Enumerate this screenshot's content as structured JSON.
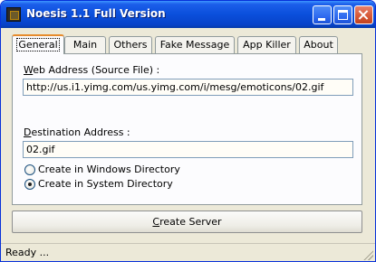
{
  "window": {
    "title": "Noesis 1.1 Full Version"
  },
  "tabs": [
    {
      "label": "General",
      "active": true
    },
    {
      "label": "Main",
      "active": false
    },
    {
      "label": "Others",
      "active": false
    },
    {
      "label": "Fake Message",
      "active": false
    },
    {
      "label": "App Killer",
      "active": false
    },
    {
      "label": "About",
      "active": false
    }
  ],
  "general": {
    "web_address_label_mnemonic": "W",
    "web_address_label_rest": "eb Address (Source File) :",
    "web_address_value": "http://us.i1.yimg.com/us.yimg.com/i/mesg/emoticons/02.gif",
    "destination_label_mnemonic": "D",
    "destination_label_rest": "estination Address :",
    "destination_value": "02.gif",
    "radio_options": [
      {
        "label": "Create in Windows Directory",
        "checked": false
      },
      {
        "label": "Create in System Directory",
        "checked": true
      }
    ]
  },
  "create_button": {
    "mnemonic": "C",
    "rest": "reate Server"
  },
  "status": {
    "text": "Ready ..."
  },
  "icons": {
    "app": "app-icon",
    "minimize": "minimize-icon",
    "maximize": "maximize-icon",
    "close": "close-icon"
  }
}
